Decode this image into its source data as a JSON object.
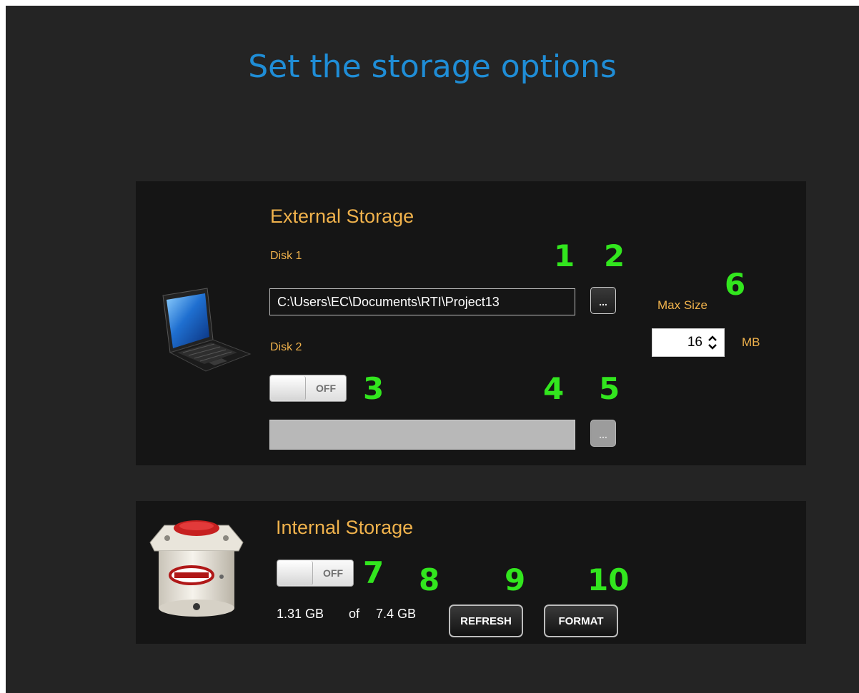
{
  "page": {
    "title": "Set the storage options"
  },
  "external": {
    "title": "External Storage",
    "disk1_label": "Disk 1",
    "disk1_path": "C:\\Users\\EC\\Documents\\RTI\\Project13",
    "browse_label": "...",
    "disk2_label": "Disk 2",
    "disk2_toggle": "OFF",
    "disk2_path": "",
    "max_size_label": "Max Size",
    "max_size_value": "16",
    "max_size_unit": "MB"
  },
  "internal": {
    "title": "Internal Storage",
    "toggle": "OFF",
    "used": "1.31 GB",
    "of": "of",
    "total": "7.4 GB",
    "refresh_label": "REFRESH",
    "format_label": "FORMAT"
  },
  "callouts": [
    "1",
    "2",
    "3",
    "4",
    "5",
    "6",
    "7",
    "8",
    "9",
    "10"
  ],
  "icons": {
    "external": "laptop-icon",
    "internal": "internal-recorder-device-icon",
    "spinner": "up-down-arrows-icon"
  },
  "colors": {
    "title": "#1f8dd6",
    "label": "#f0b24c",
    "callout": "#32e61e",
    "background": "#242424",
    "panel": "#151515"
  }
}
